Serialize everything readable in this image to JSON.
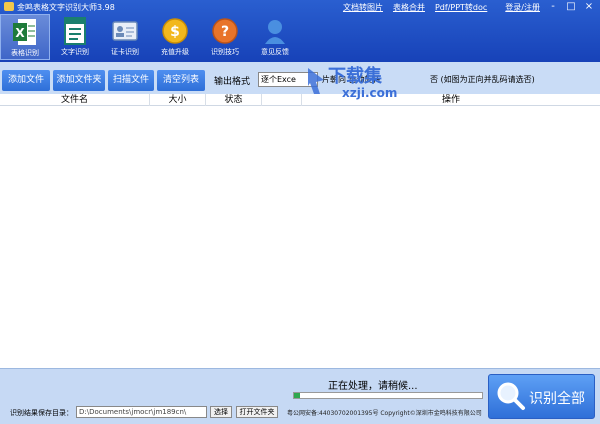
{
  "app": {
    "title": "金鸣表格文字识别大师3.98",
    "top_links": [
      "文档转图片",
      "表格合并",
      "Pdf/PPT转doc"
    ],
    "login": "登录/注册",
    "window_controls": [
      "-",
      "□",
      "×"
    ]
  },
  "iconbar": [
    {
      "label": "表格识别",
      "icon": "excel-icon",
      "active": true
    },
    {
      "label": "文字识别",
      "icon": "document-icon",
      "active": false
    },
    {
      "label": "证卡识别",
      "icon": "id-card-icon",
      "active": false
    },
    {
      "label": "充值升级",
      "icon": "coin-icon",
      "active": false
    },
    {
      "label": "识别技巧",
      "icon": "help-icon",
      "active": false
    },
    {
      "label": "意见反馈",
      "icon": "feedback-icon",
      "active": false
    }
  ],
  "toolbar": {
    "buttons": [
      "添加文件",
      "添加文件夹",
      "扫描文件",
      "清空列表"
    ],
    "format_label": "输出格式",
    "format_value": "逐个Exce",
    "option1": "片朝向 自动旋转",
    "option2": "否 (如图为正向并乱码请选否)"
  },
  "table": {
    "headers": [
      "文件名",
      "大小",
      "状态",
      "",
      "操作"
    ],
    "rows": []
  },
  "watermark": {
    "main": "下载集",
    "sub": "xzji.com"
  },
  "bottom": {
    "status": "正在处理，请稍候...",
    "progress": 0.03,
    "save_label": "识别结果保存目录：",
    "save_path": "D:\\Documents\\jmocr\\jm189cn\\",
    "select_button": "选择",
    "open_folder_button": "打开文件夹",
    "info": "粤公网安备:44030702001395号 Copyright©深圳市金鸣科技有限公司",
    "recognize_all": "识别全部"
  },
  "colors": {
    "header": "#1f4fc2",
    "toolbar": "#c9dcf6",
    "button": "#3a7ee6",
    "progress": "#2fa84f"
  }
}
